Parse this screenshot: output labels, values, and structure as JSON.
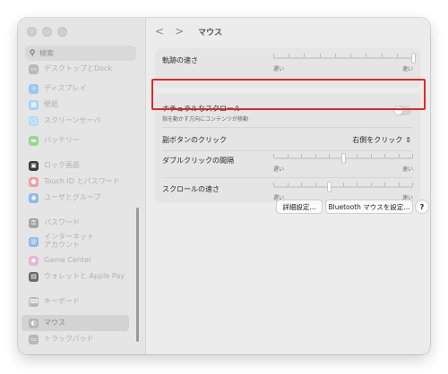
{
  "sidebar": {
    "search_placeholder": "検索",
    "items": [
      {
        "label": "デスクトップとDock",
        "icon": "dock-icon",
        "color": "#b9b9b9"
      },
      {
        "label": "ディスプレイ",
        "icon": "display-icon",
        "color": "#9cc5f2"
      },
      {
        "label": "壁紙",
        "icon": "wallpaper-icon",
        "color": "#a7d1f6"
      },
      {
        "label": "スクリーンセーバ",
        "icon": "screensaver-icon",
        "color": "#b6ddf7"
      },
      {
        "label": "バッテリー",
        "icon": "battery-icon",
        "color": "#98d68f"
      },
      {
        "label": "ロック画面",
        "icon": "lock-icon",
        "color": "#3a3a3a"
      },
      {
        "label": "Touch ID とパスワード",
        "icon": "fingerprint-icon",
        "color": "#f2a0a0"
      },
      {
        "label": "ユーザとグループ",
        "icon": "users-icon",
        "color": "#8fb8ee"
      },
      {
        "label": "パスワード",
        "icon": "key-icon",
        "color": "#a4a4a4"
      },
      {
        "label": "インターネット\nアカウント",
        "icon": "at-icon",
        "color": "#8fb8ee"
      },
      {
        "label": "Game Center",
        "icon": "game-center-icon",
        "color": "#e9b6d6"
      },
      {
        "label": "ウォレットと Apple Pay",
        "icon": "wallet-icon",
        "color": "#6b6b6b"
      },
      {
        "label": "キーボード",
        "icon": "keyboard-icon",
        "color": "#b8b8b8"
      },
      {
        "label": "マウス",
        "icon": "mouse-icon",
        "color": "#b8b8b8",
        "selected": true
      },
      {
        "label": "トラックパッド",
        "icon": "trackpad-icon",
        "color": "#b8b8b8"
      }
    ]
  },
  "toolbar": {
    "back": "<",
    "forward": ">",
    "title": "マウス"
  },
  "settings": {
    "tracking": {
      "label": "軌跡の速さ",
      "lo": "遅い",
      "hi": "速い",
      "value": 1.0
    },
    "natural_scroll": {
      "label": "ナチュラルなスクロール",
      "sub": "指を動かす方向にコンテンツが移動",
      "on": false
    },
    "secondary_click": {
      "label": "副ボタンのクリック",
      "value": "右側をクリック"
    },
    "double_click": {
      "label": "ダブルクリックの間隔",
      "lo": "遅い",
      "hi": "速い",
      "value": 0.5
    },
    "scroll_speed": {
      "label": "スクロールの速さ",
      "lo": "遅い",
      "hi": "速い",
      "value": 0.4
    }
  },
  "buttons": {
    "advanced": "詳細設定...",
    "bluetooth": "Bluetooth マウスを設定...",
    "help": "?"
  },
  "colors": {
    "highlight": "#dd2a24"
  }
}
